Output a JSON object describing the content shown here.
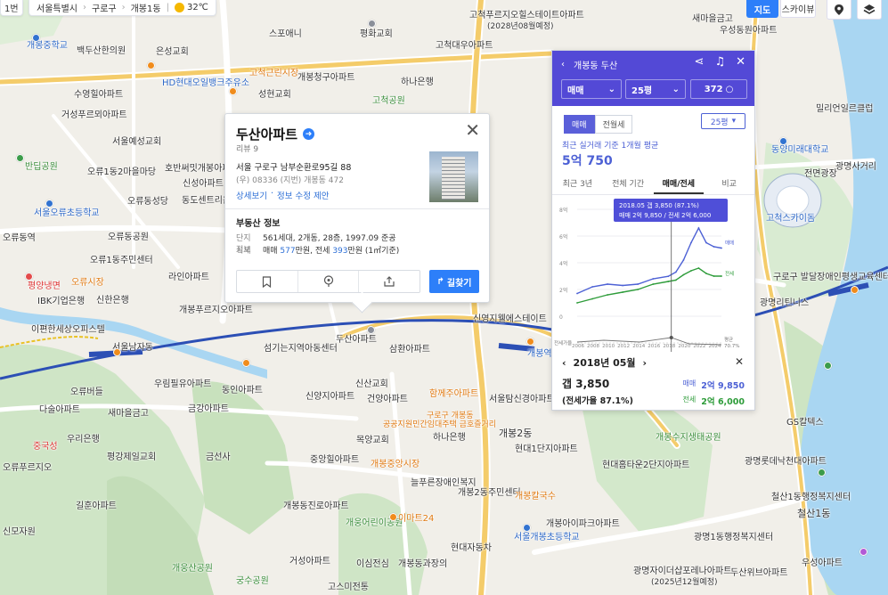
{
  "top": {
    "crumb_left": "1번",
    "region": [
      "서울특별시",
      "구로구",
      "개봉1동"
    ],
    "temp": "32℃",
    "map_btn": "지도",
    "sky_btn": "스카이뷰"
  },
  "colors": {
    "accent": "#2d7ff9",
    "panel": "#5349d6",
    "sale": "#4d61d5",
    "jeonse": "#2e9c3a"
  },
  "map_labels": [
    "개봉중학교",
    "백두산한의원",
    "은성교회",
    "스포애니",
    "평화교회",
    "고척대우아파트",
    "고척푸르지오힐스테이트아파트",
    "(2028년08월예정)",
    "고척공원",
    "거성푸르뫼아파트",
    "서울예성교회",
    "HD현대오일뱅크주유소",
    "개봉청구아파트",
    "고척근린시장",
    "성현교회",
    "수영힐아파트",
    "반딥공원",
    "오류1동2마을마당",
    "호반써밋개봉아파트",
    "오류동성당",
    "동도센트리움아파트",
    "신성아파트",
    "서울오류초등학교",
    "오류동역",
    "오류동공원",
    "오류1동주민센터",
    "라인아파트",
    "평양냉면",
    "오류시장",
    "IBK기업은행",
    "신한은행",
    "이편한세상오피스텔",
    "개봉푸르지오아파트",
    "오류버들",
    "서울남자동",
    "두산아파트",
    "삼환아파트",
    "신영지웰에스테이트",
    "개봉역",
    "섬기는지역아동센터",
    "신산교회",
    "우림필유아파트",
    "동인아파트",
    "금강아파트",
    "신양지아파트",
    "건양아파트",
    "함께주아파트",
    "구로구 개봉동",
    "공공지원민간임대주택 금호즐거리",
    "서울탐신경아파트",
    "하나은행",
    "개봉2동",
    "새마을금고",
    "우리은행",
    "평강제일교회",
    "금선사",
    "목양교회",
    "개봉중앙시장",
    "중앙힐아파트",
    "현대1단지아파트",
    "현대홈타운2단지아파트",
    "늘푸른장애인복지",
    "개봉2동주민센터",
    "개봉칼국수",
    "개봉동진로아파트",
    "개웅어린이공원",
    "이마트24",
    "현대자동차",
    "서울개봉초등학교",
    "개봉아이파크아파트",
    "거성아파트",
    "이심전심",
    "개봉동과장의",
    "궁수공원",
    "고스미전통",
    "개웅산공원",
    "길훈아파트",
    "다술아파트",
    "오류푸르지오",
    "중국성",
    "신모자원",
    "개봉수지생태공원",
    "광명롯데낙천대아파트",
    "철산1동행정복지센터",
    "광명자이더샵포레나아파트",
    "(2025년12월예정)",
    "광명1동행정복지센터",
    "두산위브아파트",
    "우성아파트",
    "고척스카이돔",
    "구로구 발달장애인평생교육센터",
    "동양미래대학교",
    "전면광장",
    "GS칼텍스",
    "광명사거리",
    "철산1동",
    "하나은행",
    "새마을금고",
    "우성동원아파트",
    "밀리언일르클럽",
    "광명리틴니스"
  ],
  "place": {
    "title": "두산아파트",
    "reviews": "리뷰 9",
    "address": "서울 구로구 남부순환로95길 88",
    "address2": "(우) 08336 (지번) 개봉동 472",
    "link_detail": "상세보기",
    "link_edit": "정보 수정 제안",
    "section": "부동산 정보",
    "info_key": "단지정보",
    "info_val": "561세대, 2개동, 28층, 1997.09 준공",
    "price_key": "시세",
    "price_prefix": "매매 ",
    "price_sale": "577",
    "price_mid": "만원, 전세 ",
    "price_jeonse": "393",
    "price_suffix": "만원 (1㎡기준)",
    "route_btn": "길찾기",
    "icons": [
      "bookmark-icon",
      "pin-icon",
      "share-icon"
    ]
  },
  "panel": {
    "title": "개봉동 두산",
    "sel_trade": "매매",
    "sel_size": "25평",
    "sel_count": "372",
    "tab_sale": "매매",
    "tab_jeonse": "전월세",
    "size_btn": "25평",
    "recent_text": "최근 실거래 기준 1개월 평균",
    "recent_price": "5억 750",
    "subtabs": [
      "최근 3년",
      "전체 기간",
      "매매/전세",
      "비교"
    ],
    "active_subtab": 2,
    "tooltip_line1": "2018.05 갭 3,850 (87.1%)",
    "tooltip_line2": "매매 2억 9,850 / 전세 2억 6,000",
    "nav_label": "2018년 05월",
    "gap_label": "갭 3,850",
    "rate_label": "(전세가율 87.1%)",
    "sale_tag": "매매",
    "sale_val": "2억 9,850",
    "jeonse_tag": "전세",
    "jeonse_val": "2억 6,000"
  },
  "chart_data": {
    "type": "line",
    "x_ticks": [
      "2006",
      "2008",
      "2010",
      "2012",
      "2014",
      "2016",
      "2018",
      "2020",
      "2022",
      "2024"
    ],
    "y_ticks": [
      "8억",
      "6억",
      "4억",
      "2억",
      "0"
    ],
    "ylim": [
      0,
      8
    ],
    "legend": [
      "매매",
      "전세"
    ],
    "rate_label": "전세가율",
    "avg_label": "평균",
    "avg_val": "70.7%",
    "series": [
      {
        "name": "매매",
        "x": [
          2006,
          2008,
          2010,
          2012,
          2014,
          2016,
          2018,
          2019,
          2020,
          2021,
          2022,
          2023,
          2024,
          2025
        ],
        "values": [
          1.7,
          2.2,
          2.4,
          2.3,
          2.4,
          2.8,
          2.985,
          3.3,
          4.2,
          5.5,
          6.6,
          5.5,
          5.2,
          5.1
        ]
      },
      {
        "name": "전세",
        "x": [
          2006,
          2008,
          2010,
          2012,
          2014,
          2016,
          2018,
          2019,
          2020,
          2021,
          2022,
          2023,
          2024,
          2025
        ],
        "values": [
          1.0,
          1.3,
          1.6,
          1.8,
          2.0,
          2.4,
          2.6,
          2.7,
          3.1,
          3.4,
          3.6,
          3.2,
          3.0,
          3.0
        ]
      }
    ],
    "marker_x": 2018.4
  }
}
